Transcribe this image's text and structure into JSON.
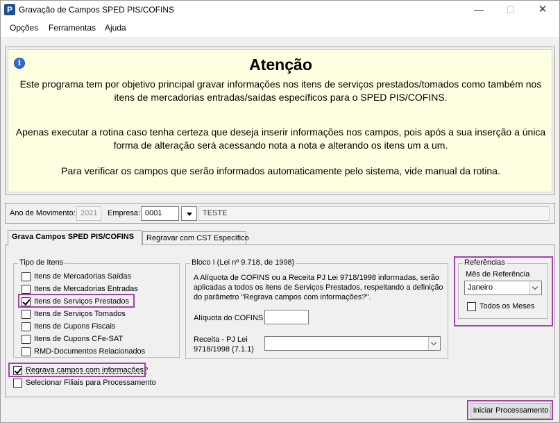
{
  "window": {
    "title": "Gravação de Campos SPED PIS/COFINS",
    "app_icon_letter": "P",
    "minimize": "—",
    "maximize": "☐",
    "close": "✕"
  },
  "menu": [
    "Opções",
    "Ferramentas",
    "Ajuda"
  ],
  "notice": {
    "info_icon": "i",
    "title": "Atenção",
    "paragraphs": [
      "Este programa tem por objetivo principal gravar informações nos itens de serviços prestados/tomados como também nos itens de mercadorias entradas/saídas específicos para o SPED PIS/COFINS.",
      "Apenas executar a rotina caso tenha certeza que deseja inserir informações nos campos, pois após a sua inserção a única forma de alteração será acessando nota a nota e alterando os itens um a um.",
      "Para verificar os campos que serão informados automaticamente pelo sistema, vide manual da rotina."
    ]
  },
  "filters": {
    "ano_label": "Ano de Movimento:",
    "ano_value": "2021",
    "empresa_label": "Empresa:",
    "empresa_code": "0001",
    "empresa_name": "TESTE"
  },
  "tabs": [
    "Grava Campos SPED PIS/COFINS",
    "Regravar com CST Específico"
  ],
  "tipo_itens": {
    "label": "Tipo de Itens",
    "items": [
      {
        "label": "Itens de Mercadorias Saídas",
        "checked": false
      },
      {
        "label": "Itens de Mercadorias Entradas",
        "checked": false
      },
      {
        "label": "Itens de Serviços Prestados",
        "checked": true
      },
      {
        "label": "Itens de Serviços Tomados",
        "checked": false
      },
      {
        "label": "Itens de Cupons Fiscais",
        "checked": false
      },
      {
        "label": "Itens de Cupons CFe-SAT",
        "checked": false
      },
      {
        "label": "RMD-Documentos Relacionados",
        "checked": false
      }
    ]
  },
  "options": {
    "regrava": {
      "label": "Regrava campos com informações?",
      "checked": true
    },
    "filiais": {
      "label": "Selecionar Filiais para Processamento",
      "checked": false
    }
  },
  "bloco": {
    "label": "Bloco I (Lei nº 9.718, de 1998)",
    "text": "A Alíquota de COFINS ou a Receita PJ Lei 9718/1998 informadas, serão aplicadas a todos os itens de Serviços Prestados, respeitando a definição do parâmetro \"Regrava campos com informações?\".",
    "aliquota_label": "Alíquota do COFINS",
    "aliquota_value": "",
    "receita_label_1": "Receita - PJ Lei",
    "receita_label_2": "9718/1998 (7.1.1)",
    "receita_value": ""
  },
  "referencias": {
    "label": "Referências",
    "mes_label": "Mês de Referência",
    "mes_value": "Janeiro",
    "todos_label": "Todos os Meses",
    "todos_checked": false
  },
  "actions": {
    "iniciar": "Iniciar Processamento"
  },
  "colors": {
    "highlight": "#a044a4",
    "notice_bg": "#ffffe1",
    "window_bg": "#f0f0f0"
  }
}
